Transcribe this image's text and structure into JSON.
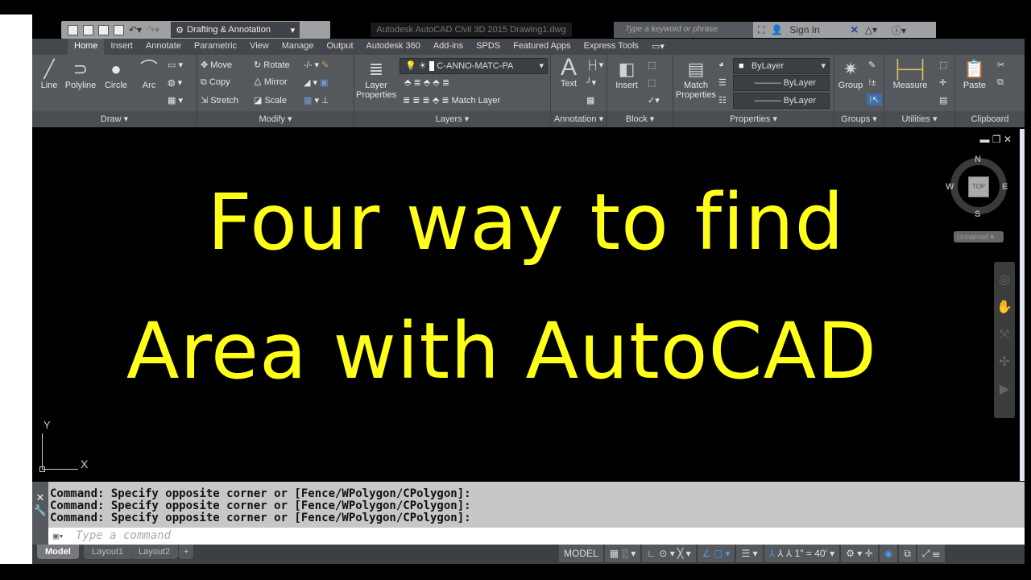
{
  "quick_access": {
    "workspace": "Drafting & Annotation"
  },
  "title": "Autodesk AutoCAD Civil 3D 2015    Drawing1.dwg",
  "search": {
    "placeholder": "Type a keyword or phrase"
  },
  "sign_in": "Sign In",
  "tabs": [
    "Home",
    "Insert",
    "Annotate",
    "Parametric",
    "View",
    "Manage",
    "Output",
    "Autodesk 360",
    "Add-ins",
    "SPDS",
    "Featured Apps",
    "Express Tools"
  ],
  "ribbon": {
    "draw": {
      "title": "Draw",
      "line": "Line",
      "polyline": "Polyline",
      "circle": "Circle",
      "arc": "Arc"
    },
    "modify": {
      "title": "Modify",
      "move": "Move",
      "rotate": "Rotate",
      "copy": "Copy",
      "mirror": "Mirror",
      "stretch": "Stretch",
      "scale": "Scale"
    },
    "layers": {
      "title": "Layers",
      "layer_properties": "Layer Properties",
      "current_layer": "C-ANNO-MATC-PA",
      "match_layer": "Match Layer"
    },
    "annotation": {
      "title": "Annotation",
      "text": "Text"
    },
    "block": {
      "title": "Block",
      "insert": "Insert"
    },
    "properties": {
      "title": "Properties",
      "match_properties": "Match Properties",
      "color": "ByLayer",
      "linetype": "ByLayer",
      "lineweight": "ByLayer"
    },
    "groups": {
      "title": "Groups",
      "group": "Group"
    },
    "utilities": {
      "title": "Utilities",
      "measure": "Measure"
    },
    "clipboard": {
      "title": "Clipboard",
      "paste": "Paste"
    }
  },
  "canvas": {
    "line1": "Four way to find",
    "line2": "Area with AutoCAD",
    "ucs_x": "X",
    "ucs_y": "Y",
    "viewcube": {
      "n": "N",
      "s": "S",
      "e": "E",
      "w": "W",
      "face": "TOP",
      "ucs": "Unnamed"
    }
  },
  "command": {
    "history": [
      "Command: Specify opposite corner or [Fence/WPolygon/CPolygon]:",
      "Command: Specify opposite corner or [Fence/WPolygon/CPolygon]:",
      "Command: Specify opposite corner or [Fence/WPolygon/CPolygon]:"
    ],
    "placeholder": "Type a command"
  },
  "layout_tabs": [
    "Model",
    "Layout1",
    "Layout2",
    "+"
  ],
  "status": {
    "space": "MODEL",
    "scale": "1\" = 40'"
  },
  "colors": {
    "text": "#ffff1a",
    "canvas": "#000000",
    "ribbon": "#55585d"
  }
}
